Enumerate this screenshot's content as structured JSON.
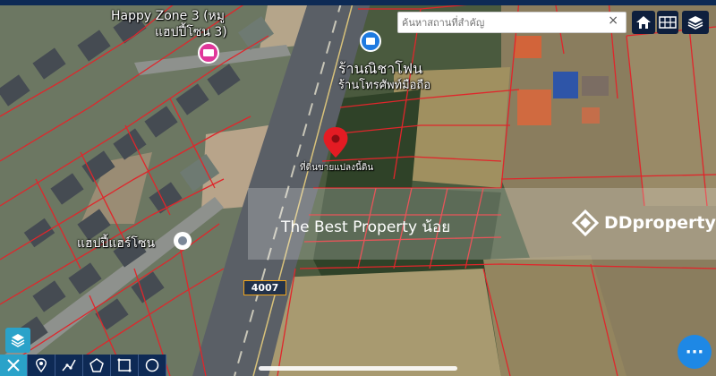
{
  "search": {
    "placeholder": "ค้นหาสถานที่สำคัญ",
    "close_symbol": "×"
  },
  "map": {
    "labels": {
      "happy_zone_top": "Happy Zone 3 (หมู",
      "happy_zone_bottom": "แฮปปี้โซน 3)",
      "shop_top": "ร้านณิชาโฟน",
      "shop_bottom": "ร้านโทรศัพท์มือถือ",
      "pin_caption": "ที่ดินขายแปลงนี้ดิน",
      "happy_zone_small": "แฮปปี้แฮร์โซน",
      "road_number": "4007"
    },
    "colors": {
      "parcel_line": "#e0262b",
      "pin": "#e31b23",
      "road": "#5a5f66"
    }
  },
  "watermark": {
    "text": "The Best Property น้อย",
    "brand": "DDproperty"
  },
  "toolbar": {
    "icons": [
      "home-icon",
      "grid-icon",
      "layers-icon"
    ]
  },
  "bottom_tools": {
    "icons": [
      "tools-icon",
      "location-pin-icon",
      "polyline-icon",
      "polygon-icon",
      "rectangle-icon",
      "circle-icon"
    ]
  },
  "more_button": {
    "label": "···"
  }
}
